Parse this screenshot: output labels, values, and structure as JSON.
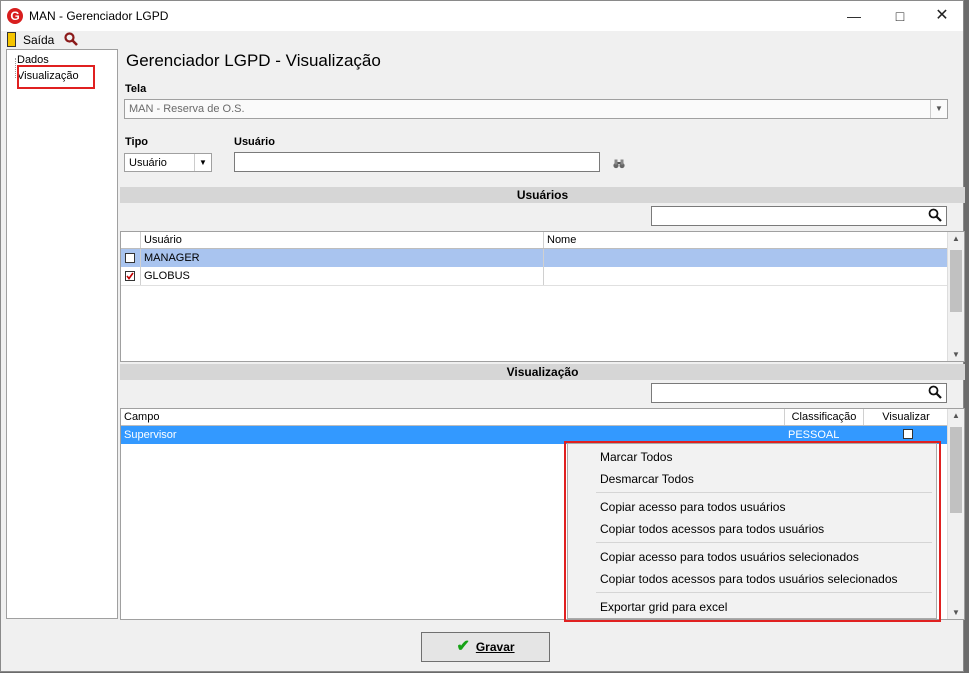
{
  "window": {
    "title": "MAN - Gerenciador LGPD",
    "app_icon": "G"
  },
  "menubar": {
    "exit_label": "Saída"
  },
  "tree": {
    "items": [
      "Dados",
      "Visualização"
    ]
  },
  "page": {
    "title": "Gerenciador LGPD - Visualização"
  },
  "form": {
    "tela_label": "Tela",
    "tela_value": "MAN - Reserva de O.S.",
    "tipo_label": "Tipo",
    "tipo_value": "Usuário",
    "usuario_label": "Usuário",
    "usuario_value": ""
  },
  "users_section": {
    "title": "Usuários",
    "search_value": "",
    "columns": [
      "Usuário",
      "Nome"
    ],
    "rows": [
      {
        "usuario": "MANAGER",
        "nome": "",
        "checked": false,
        "selected": true
      },
      {
        "usuario": "GLOBUS",
        "nome": "",
        "checked": true,
        "selected": false
      }
    ]
  },
  "view_section": {
    "title": "Visualização",
    "search_value": "",
    "columns": [
      "Campo",
      "Classificação",
      "Visualizar"
    ],
    "rows": [
      {
        "campo": "Supervisor",
        "classificacao": "PESSOAL",
        "visualizar": false
      }
    ]
  },
  "context_menu": {
    "items": [
      "Marcar Todos",
      "Desmarcar Todos",
      "Copiar acesso para todos usuários",
      "Copiar todos acessos para todos usuários",
      "Copiar acesso para todos usuários selecionados",
      "Copiar todos acessos para todos usuários selecionados",
      "Exportar grid para excel"
    ]
  },
  "footer": {
    "save_label": "Gravar"
  },
  "colors": {
    "accent_selection": "#3399ff",
    "user_selected_row": "#a9c4ef",
    "highlight_red": "#e02020"
  }
}
